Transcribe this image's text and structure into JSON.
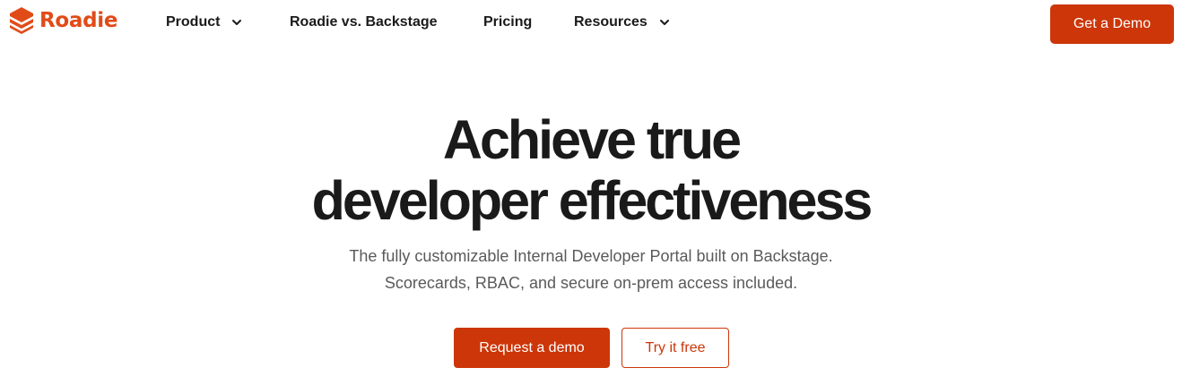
{
  "brand": {
    "name": "Roadie",
    "logo_icon": "roadie-stacked-layers-icon",
    "color": "#e14b18"
  },
  "nav": {
    "items": [
      {
        "label": "Product",
        "has_dropdown": true
      },
      {
        "label": "Roadie vs. Backstage",
        "has_dropdown": false
      },
      {
        "label": "Pricing",
        "has_dropdown": false
      },
      {
        "label": "Resources",
        "has_dropdown": true
      }
    ],
    "cta_label": "Get a Demo"
  },
  "hero": {
    "title_line1": "Achieve true",
    "title_line2": "developer effectiveness",
    "subtitle_line1": "The fully customizable Internal Developer Portal built on Backstage.",
    "subtitle_line2": "Scorecards, RBAC, and secure on-prem access included.",
    "primary_button": "Request a demo",
    "secondary_button": "Try it free"
  },
  "colors": {
    "accent": "#cc3608",
    "text": "#1a1a1a",
    "subtext": "#5a5a5a",
    "background": "#ffffff"
  }
}
